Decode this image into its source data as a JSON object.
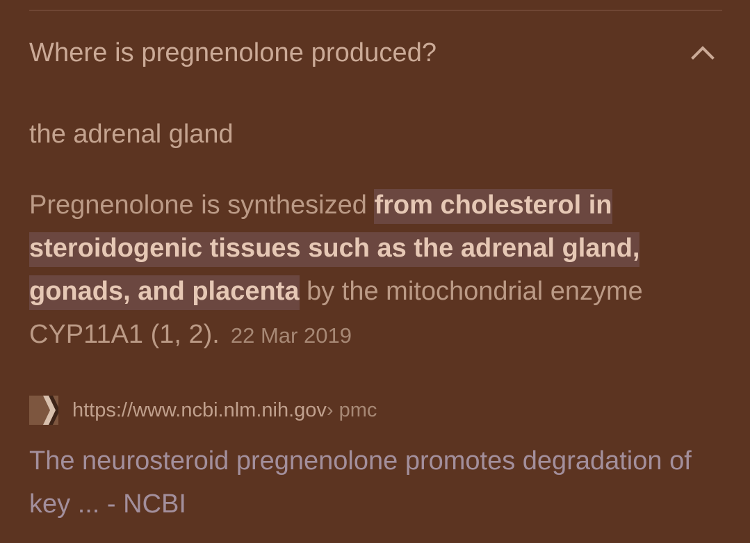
{
  "faq": {
    "question": "Where is pregnenolone produced?",
    "expanded": true,
    "toggle_icon": "chevron-up-icon",
    "short_answer": "the adrenal gland",
    "snippet": {
      "before": "Pregnenolone is synthesized ",
      "highlight": "from cholesterol in steroidogenic tissues such as the adrenal gland, gonads, and placenta",
      "after": " by the mitochondrial enzyme CYP11A1 (1, 2).",
      "date": "22 Mar 2019"
    },
    "source": {
      "favicon": "ncbi-favicon",
      "url": "https://www.ncbi.nlm.nih.gov",
      "path": " › pmc",
      "title": "The neurosteroid pregnenolone promotes degradation of key ... - NCBI"
    }
  },
  "colors": {
    "background": "#5c3421",
    "highlight_bg": "#6b4740",
    "link": "#a38f9c"
  }
}
